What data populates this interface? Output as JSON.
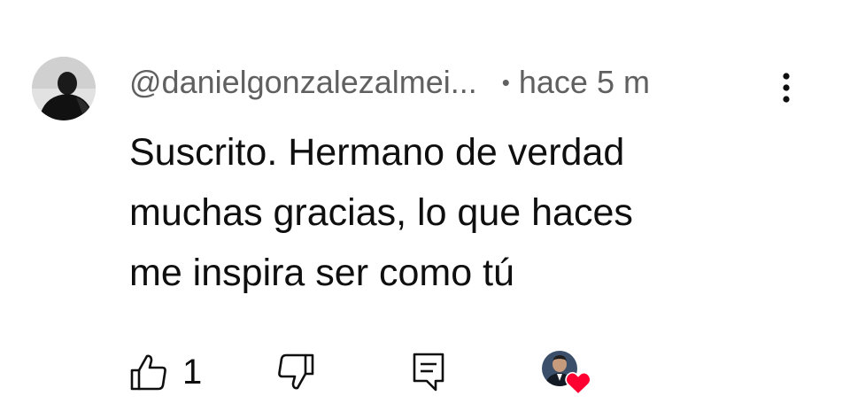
{
  "comment": {
    "author": "@danielgonzalezalmei...",
    "separator": "•",
    "timestamp": "hace 5 m",
    "text": "Suscrito. Hermano de verdad\nmuchas gracias, lo que haces\nme inspira ser como tú",
    "likes": "1",
    "liked_by_creator": true
  },
  "icons": {
    "more": "more-vert-icon",
    "like": "thumb-up-icon",
    "dislike": "thumb-down-icon",
    "reply": "comment-reply-icon",
    "creator_heart": "heart-icon"
  },
  "colors": {
    "text": "#0f0f0f",
    "secondary": "#606060",
    "heart": "#ff0033"
  }
}
